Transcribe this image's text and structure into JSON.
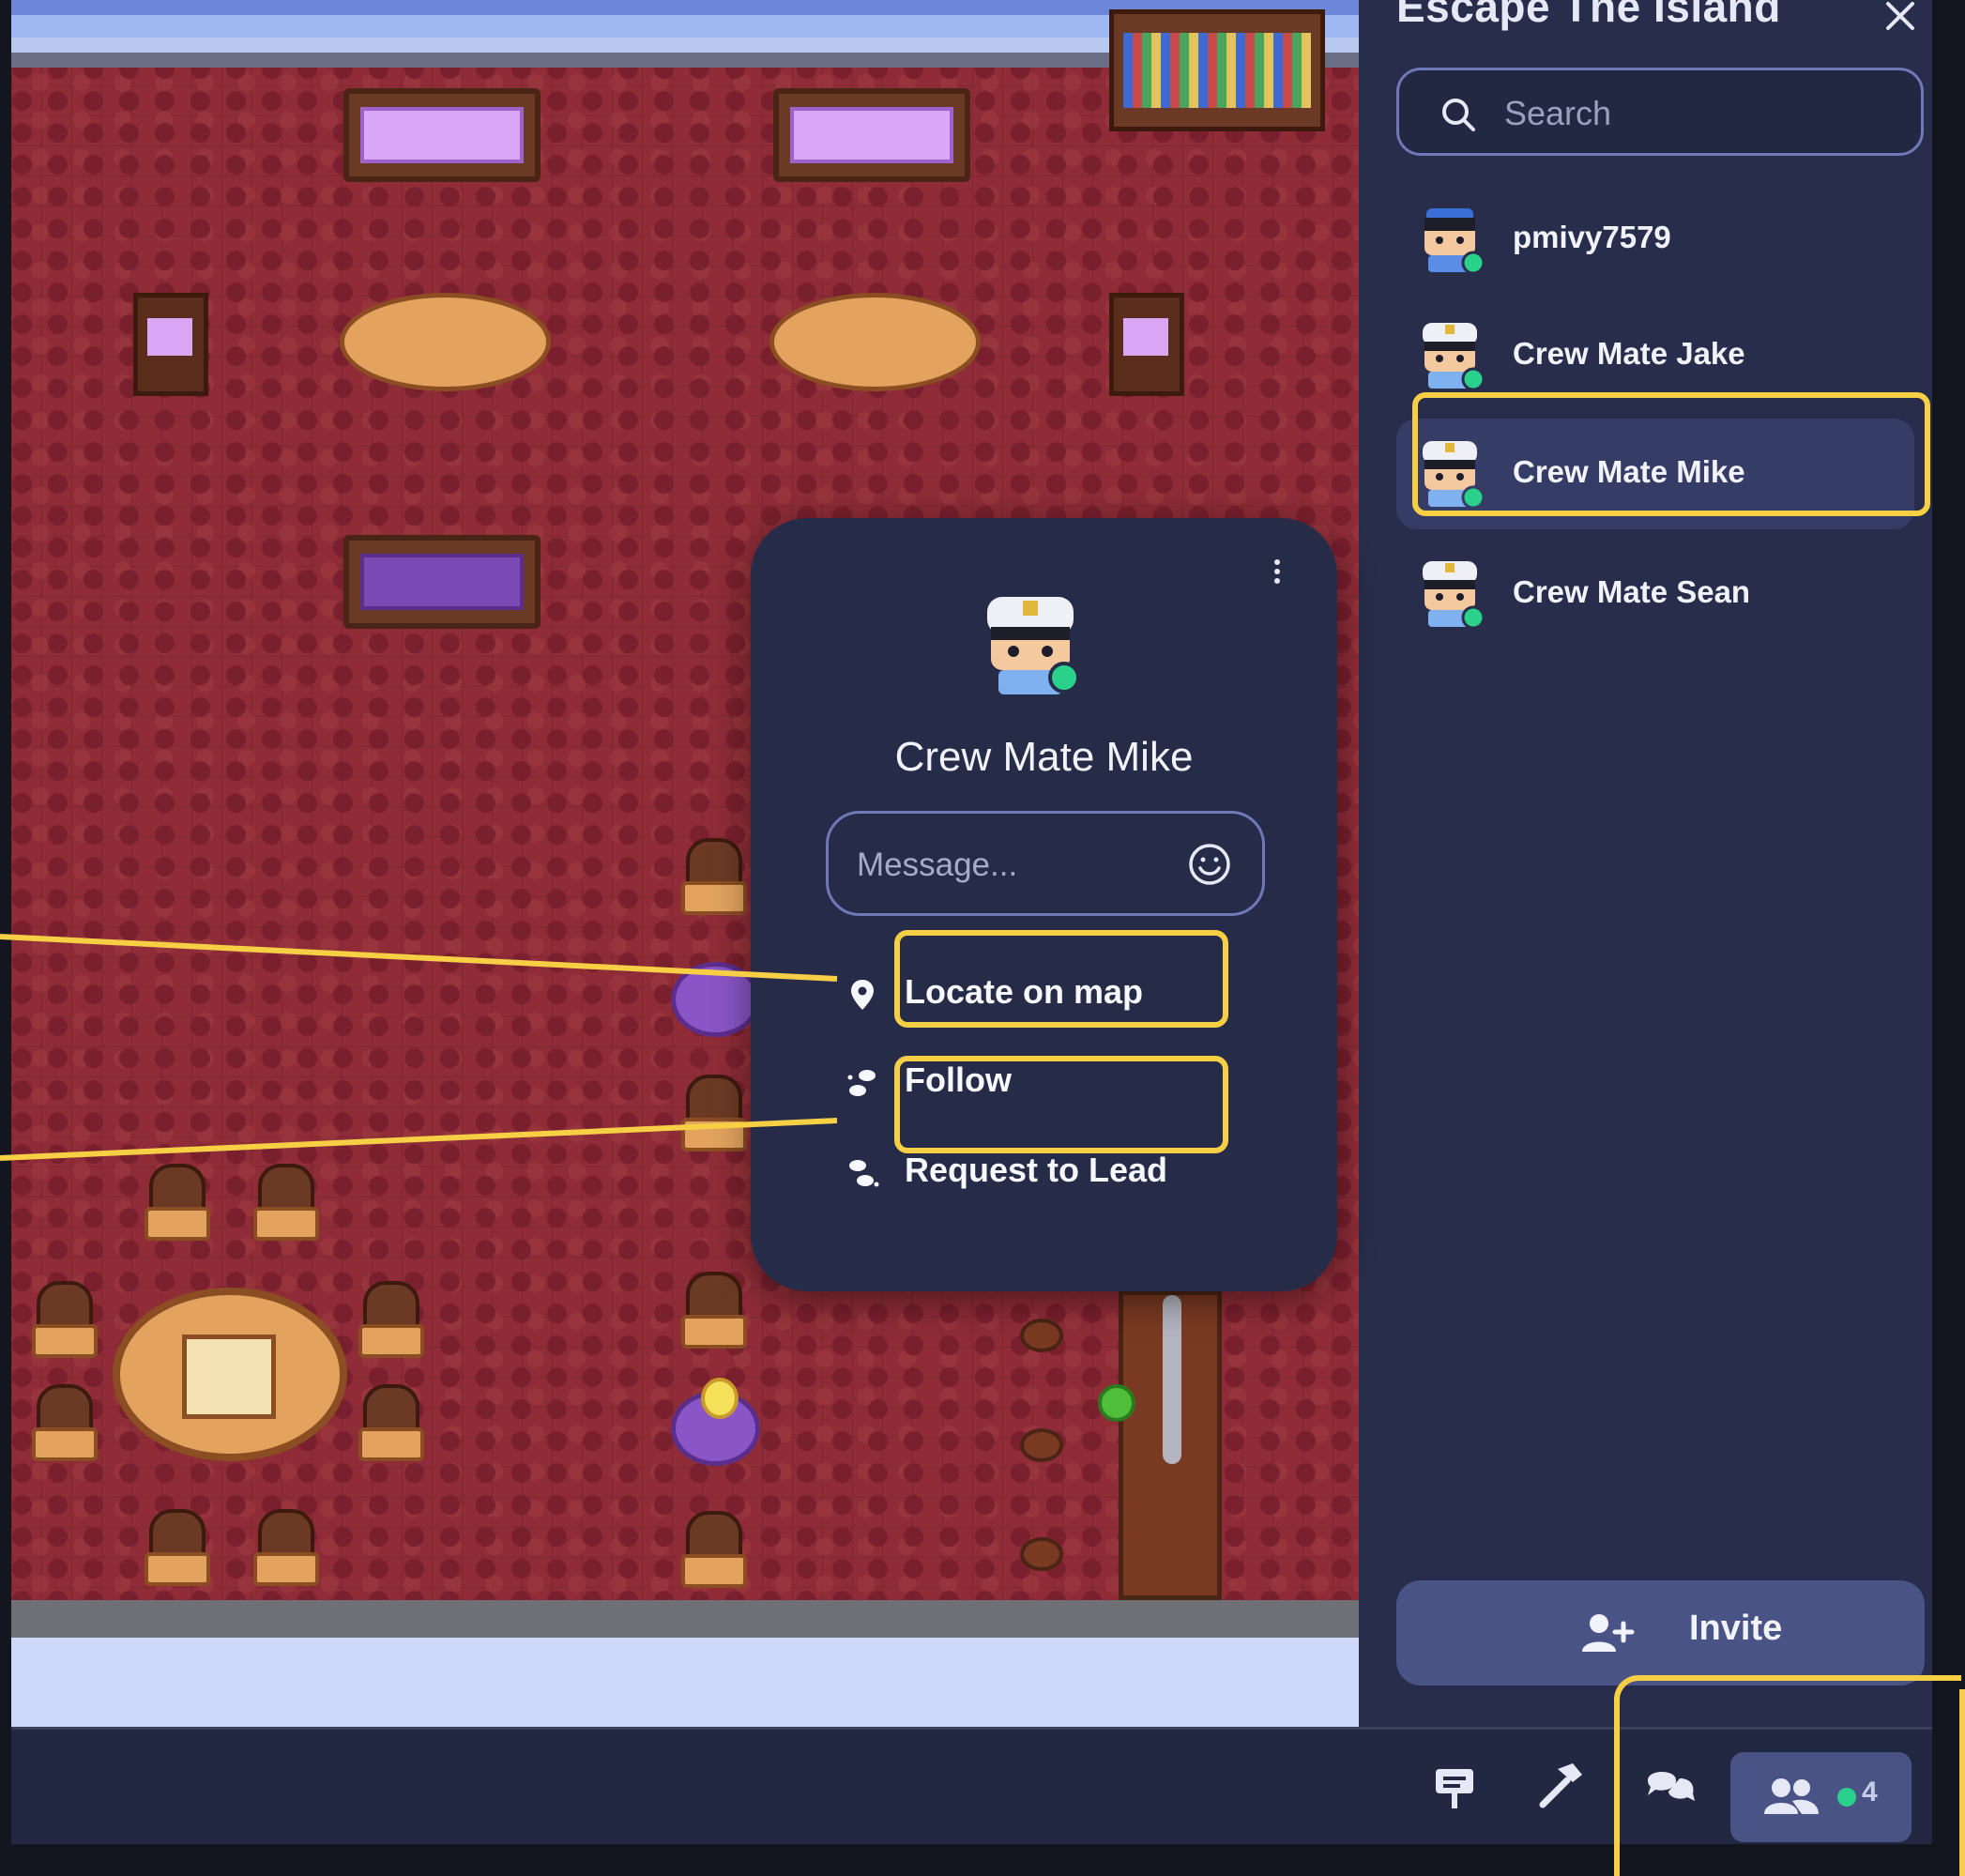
{
  "sidebar": {
    "title": "Escape The Island",
    "search": {
      "placeholder": "Search",
      "value": ""
    },
    "users": [
      {
        "name": "pmivy7579",
        "status": "online",
        "selected": false
      },
      {
        "name": "Crew Mate Jake",
        "status": "online",
        "selected": false
      },
      {
        "name": "Crew Mate Mike",
        "status": "online",
        "selected": true
      },
      {
        "name": "Crew Mate Sean",
        "status": "online",
        "selected": false
      }
    ],
    "invite_label": "Invite"
  },
  "popup": {
    "name": "Crew Mate Mike",
    "message_placeholder": "Message...",
    "actions": [
      {
        "label": "Locate on map",
        "icon": "map-pin-icon"
      },
      {
        "label": "Follow",
        "icon": "footsteps-icon"
      },
      {
        "label": "Request to Lead",
        "icon": "footsteps-lead-icon"
      }
    ]
  },
  "bottombar": {
    "icons": [
      "sign-icon",
      "hammer-icon",
      "chat-icon",
      "people-icon"
    ],
    "online_count": "4"
  },
  "colors": {
    "accent_highlight": "#f6cf45",
    "online": "#2ad18a",
    "panel": "#272d4a",
    "button": "#4a5386"
  }
}
